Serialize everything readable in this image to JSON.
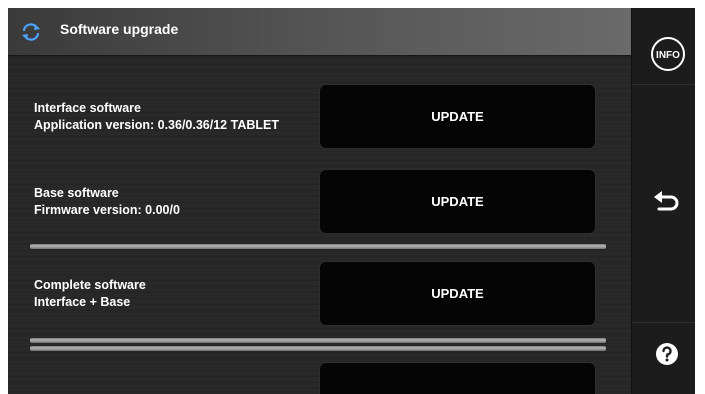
{
  "header": {
    "title": "Software upgrade",
    "icon": "sync-icon"
  },
  "rows": [
    {
      "name": "Interface software",
      "detail": "Application version: 0.36/0.36/12 TABLET",
      "button_label": "UPDATE"
    },
    {
      "name": "Base software",
      "detail": "Firmware version: 0.00/0",
      "button_label": "UPDATE"
    },
    {
      "name": "Complete software",
      "detail": "Interface + Base",
      "button_label": "UPDATE"
    }
  ],
  "sidebar": {
    "info_label": "INFO",
    "back_icon": "back-arrow-icon",
    "help_icon": "help-icon"
  },
  "colors": {
    "background": "#262626",
    "button": "#050505",
    "accent": "#4da3ff",
    "text": "#ffffff"
  }
}
